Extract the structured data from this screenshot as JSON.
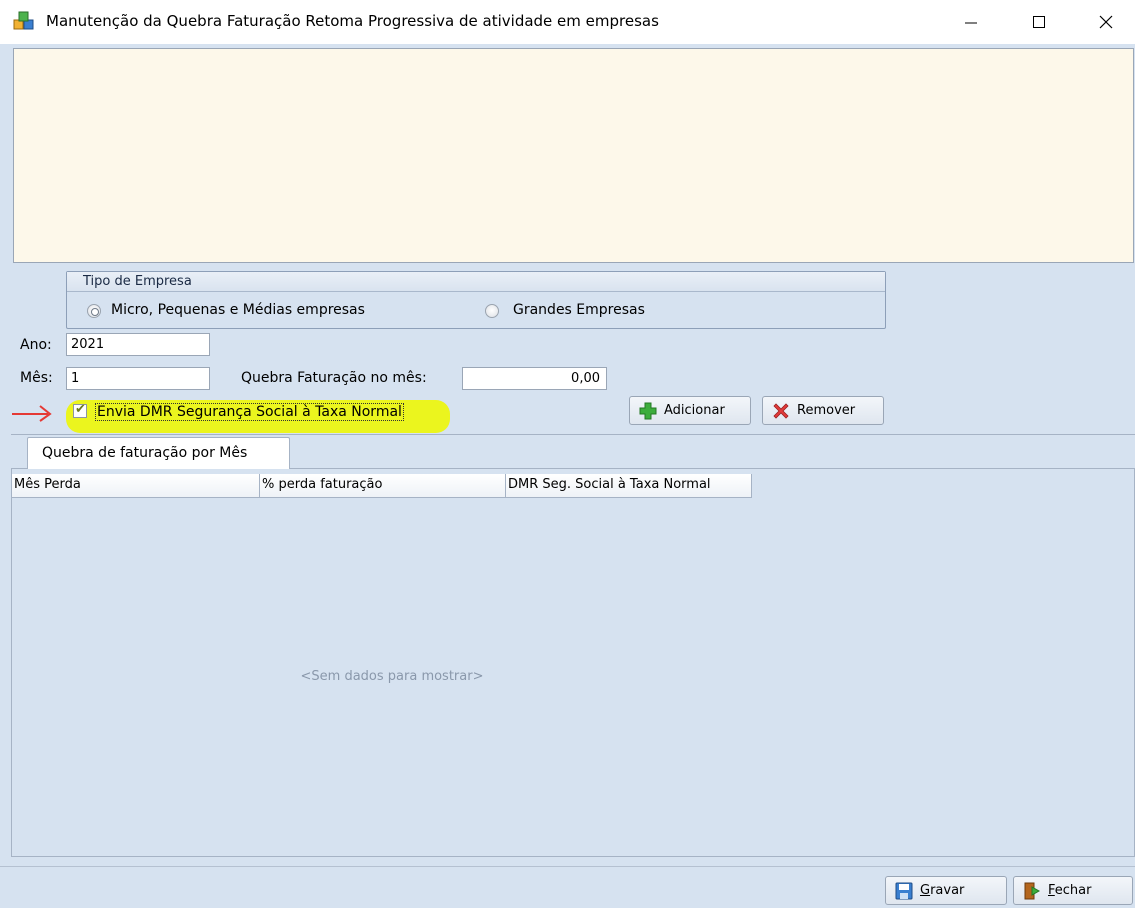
{
  "window": {
    "title": "Manutenção da Quebra Faturação Retoma Progressiva de atividade em empresas",
    "icon": "app-cubes-icon",
    "controls": {
      "minimize": "—",
      "maximize": "☐",
      "close": "✕"
    }
  },
  "tipo_empresa": {
    "title": "Tipo de Empresa",
    "options": [
      {
        "label": "Micro, Pequenas e Médias empresas",
        "selected": true
      },
      {
        "label": "Grandes Empresas",
        "selected": false
      }
    ]
  },
  "form": {
    "ano_label": "Ano:",
    "ano_value": "2021",
    "mes_label": "Mês:",
    "mes_value": "1",
    "quebra_label": "Quebra Faturação no mês:",
    "quebra_value": "0,00",
    "checkbox_label": "Envia DMR Segurança Social à Taxa Normal",
    "checkbox_checked": true
  },
  "buttons": {
    "adicionar": "Adicionar",
    "remover": "Remover",
    "gravar_first": "G",
    "gravar_rest": "ravar",
    "fechar_first": "F",
    "fechar_rest": "echar"
  },
  "tabs": [
    {
      "label": "Quebra de faturação por Mês"
    }
  ],
  "grid": {
    "columns": [
      "Mês Perda",
      "% perda faturação",
      "DMR Seg. Social à Taxa Normal"
    ],
    "rows": [],
    "empty_text": "<Sem dados para mostrar>"
  },
  "colors": {
    "client_bg": "#d6e2f0",
    "memo_bg": "#fdf8ea",
    "highlight": "#ebf51e",
    "annotation_arrow": "#e53935",
    "add_icon": "#3cad3c",
    "remove_icon": "#e23b3b"
  }
}
